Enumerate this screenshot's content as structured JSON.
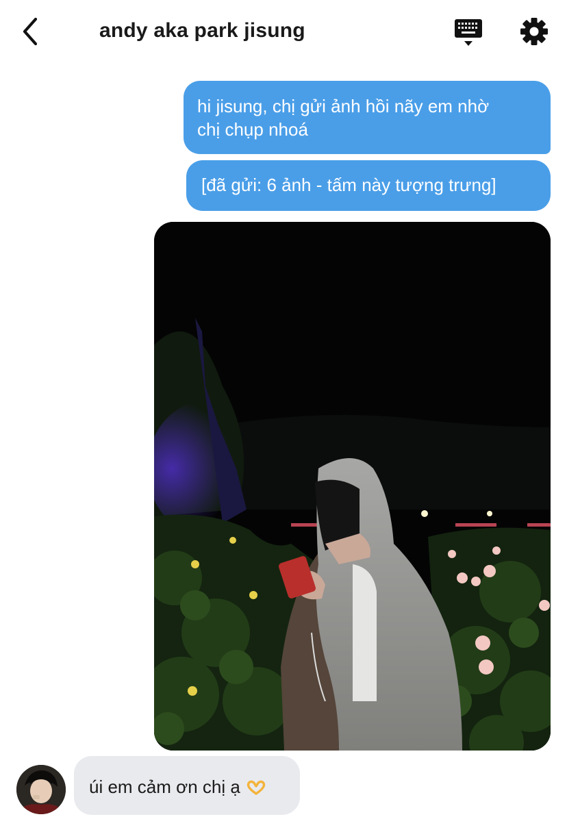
{
  "header": {
    "back_icon": "chevron-left-icon",
    "title": "andy aka park jisung",
    "keyboard_icon": "keyboard-icon",
    "settings_icon": "gear-icon"
  },
  "messages": [
    {
      "direction": "outgoing",
      "type": "text",
      "text_line1": "hi jisung, chị gửi ảnh hồi nãy em nhờ",
      "text_line2": "chị chụp nhoá"
    },
    {
      "direction": "outgoing",
      "type": "text",
      "text": "[đã gửi: 6 ảnh - tấm này tượng trưng]"
    },
    {
      "direction": "outgoing",
      "type": "image"
    },
    {
      "direction": "incoming",
      "type": "text",
      "text": "úi em cảm ơn chị ạ",
      "emoji": "heart-hands-emoji"
    }
  ],
  "colors": {
    "outgoing_bubble": "#4a9ee8",
    "incoming_bubble": "#e9eaee",
    "background": "#ffffff"
  }
}
